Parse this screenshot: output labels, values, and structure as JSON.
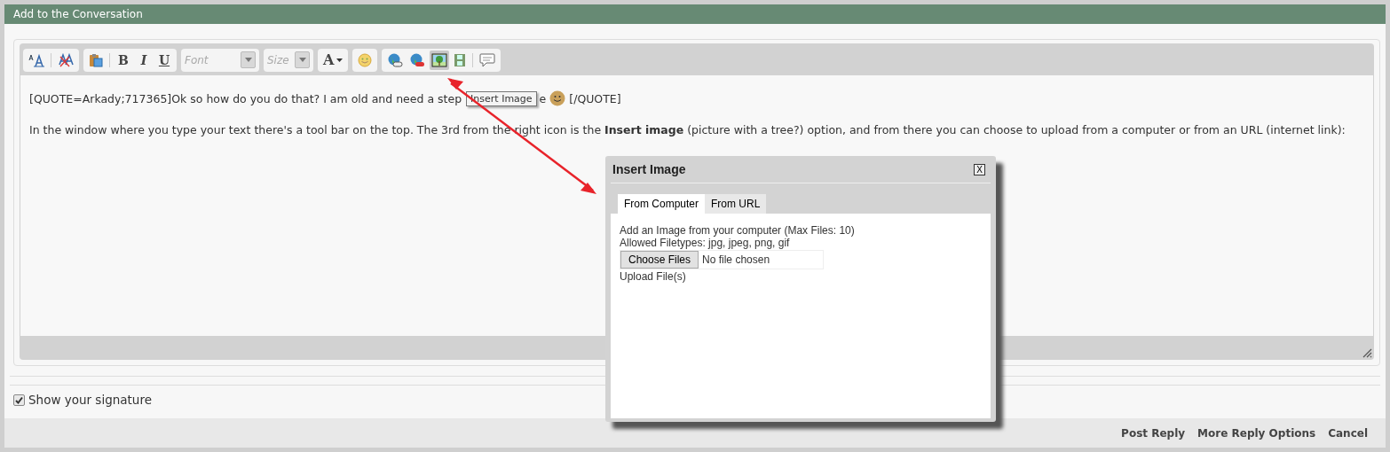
{
  "panel": {
    "title": "Add to the Conversation"
  },
  "toolbar": {
    "format_letters": [
      "B",
      "I",
      "U"
    ],
    "font_placeholder": "Font",
    "size_placeholder": "Size",
    "color_label": "A",
    "insert_image": {
      "selected": true
    }
  },
  "editor": {
    "quote_start": "[QUOTE=Arkady;717365]Ok so how do you do that? I am old and need a step",
    "tooltip": "Insert Image",
    "quote_rest": "e",
    "quote_end": "[/QUOTE]",
    "paragraph": "In the window where you type your text there's a tool bar on the top. The 3rd from the right icon is the **Insert image** (picture with a tree?) option, and from there you can choose to upload from a computer or from an URL (internet link):"
  },
  "dialog": {
    "title": "Insert Image",
    "close": "X",
    "tabs": [
      {
        "label": "From Computer",
        "selected": true
      },
      {
        "label": "From URL",
        "selected": false
      }
    ],
    "lines": [
      "Add an Image from your computer (Max Files: 10)",
      "Allowed Filetypes: jpg, jpeg, png, gif"
    ],
    "file_button": "Choose Files",
    "file_status": "No file chosen",
    "upload": "Upload File(s)"
  },
  "signature": {
    "label": "Show your signature",
    "checked": true
  },
  "actions": [
    "Post Reply",
    "More Reply Options",
    "Cancel"
  ]
}
